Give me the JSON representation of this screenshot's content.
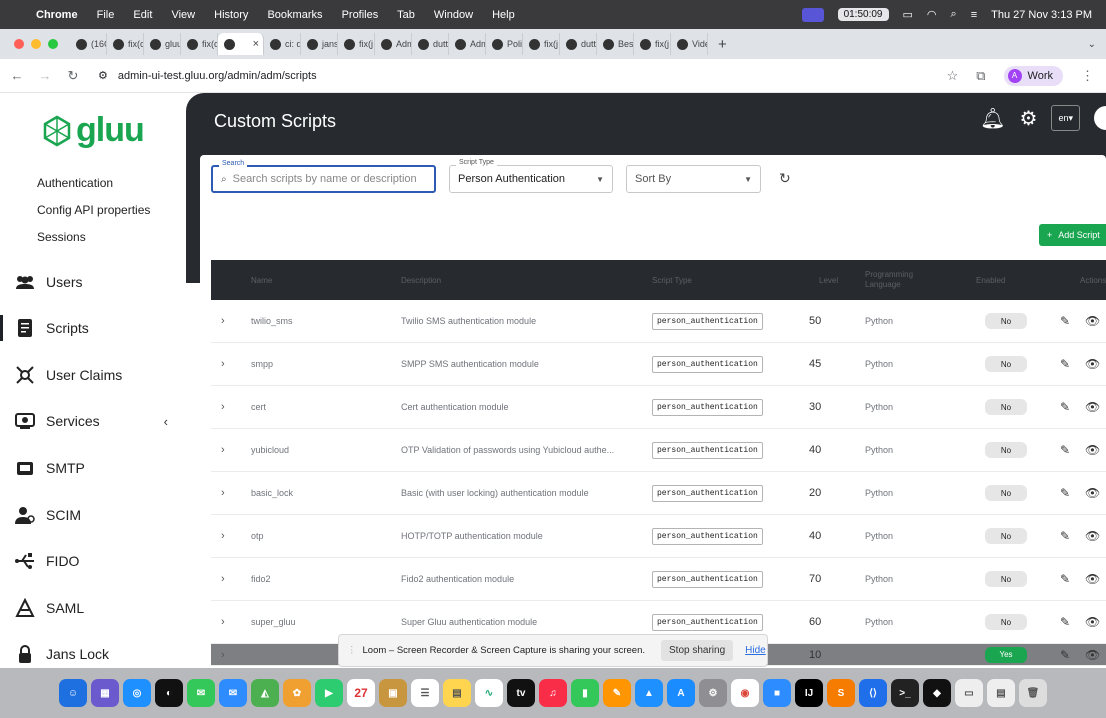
{
  "macos_menubar": {
    "app": "Chrome",
    "menus": [
      "File",
      "Edit",
      "View",
      "History",
      "Bookmarks",
      "Profiles",
      "Tab",
      "Window",
      "Help"
    ],
    "timer": "01:50:09",
    "datetime": "Thu 27 Nov  3:13 PM"
  },
  "browser": {
    "tabs": [
      "(16C",
      "fix(c",
      "gluu",
      "fix(c",
      "",
      "ci: d",
      "jans",
      "fix(j",
      "Adm",
      "dutt",
      "Adm",
      "Poli",
      "fix(j",
      "dutt",
      "Best",
      "fix(j",
      "Vide"
    ],
    "active_tab_index": 4,
    "url": "admin-ui-test.gluu.org/admin/adm/scripts",
    "profile_label": "Work",
    "profile_initial": "A"
  },
  "sidebar": {
    "logo_text": "gluu",
    "sub_items": [
      "Authentication",
      "Config API properties",
      "Sessions"
    ],
    "items": [
      {
        "label": "Users",
        "icon": "users-icon"
      },
      {
        "label": "Scripts",
        "icon": "scripts-icon",
        "active": true
      },
      {
        "label": "User Claims",
        "icon": "user-claims-icon"
      },
      {
        "label": "Services",
        "icon": "services-icon",
        "expandable": true
      },
      {
        "label": "SMTP",
        "icon": "smtp-icon"
      },
      {
        "label": "SCIM",
        "icon": "scim-icon"
      },
      {
        "label": "FIDO",
        "icon": "fido-icon"
      },
      {
        "label": "SAML",
        "icon": "saml-icon"
      },
      {
        "label": "Jans Lock",
        "icon": "lock-icon"
      }
    ]
  },
  "header": {
    "title": "Custom Scripts",
    "lang": "en"
  },
  "filters": {
    "search_label": "Search",
    "search_placeholder": "Search scripts by name or description",
    "type_label": "Script Type",
    "type_value": "Person Authentication",
    "sort_placeholder": "Sort By",
    "add_button": "Add Script"
  },
  "table": {
    "columns": [
      "Name",
      "Description",
      "Script Type",
      "Level",
      "Programming Language",
      "Enabled",
      "Actions"
    ],
    "rows": [
      {
        "name": "twilio_sms",
        "description": "Twilio SMS authentication module",
        "type": "person_authentication",
        "level": "50",
        "language": "Python",
        "enabled": "No"
      },
      {
        "name": "smpp",
        "description": "SMPP SMS authentication module",
        "type": "person_authentication",
        "level": "45",
        "language": "Python",
        "enabled": "No"
      },
      {
        "name": "cert",
        "description": "Cert authentication module",
        "type": "person_authentication",
        "level": "30",
        "language": "Python",
        "enabled": "No"
      },
      {
        "name": "yubicloud",
        "description": "OTP Validation of passwords using Yubicloud authe...",
        "type": "person_authentication",
        "level": "40",
        "language": "Python",
        "enabled": "No"
      },
      {
        "name": "basic_lock",
        "description": "Basic (with user locking) authentication module",
        "type": "person_authentication",
        "level": "20",
        "language": "Python",
        "enabled": "No"
      },
      {
        "name": "otp",
        "description": "HOTP/TOTP authentication module",
        "type": "person_authentication",
        "level": "40",
        "language": "Python",
        "enabled": "No"
      },
      {
        "name": "fido2",
        "description": "Fido2 authentication module",
        "type": "person_authentication",
        "level": "70",
        "language": "Python",
        "enabled": "No"
      },
      {
        "name": "super_gluu",
        "description": "Super Gluu authentication module",
        "type": "person_authentication",
        "level": "60",
        "language": "Python",
        "enabled": "No"
      },
      {
        "name": "",
        "description": "",
        "type": "",
        "level": "10",
        "language": "",
        "enabled": "Yes"
      }
    ]
  },
  "loom_banner": {
    "message": "Loom – Screen Recorder & Screen Capture is sharing your screen.",
    "stop_label": "Stop sharing",
    "hide_label": "Hide"
  },
  "dock": {
    "calendar_date": "27"
  },
  "colors": {
    "brand_green": "#1aa551",
    "dark_header": "#272b30",
    "focus_blue": "#2d5ab3"
  }
}
